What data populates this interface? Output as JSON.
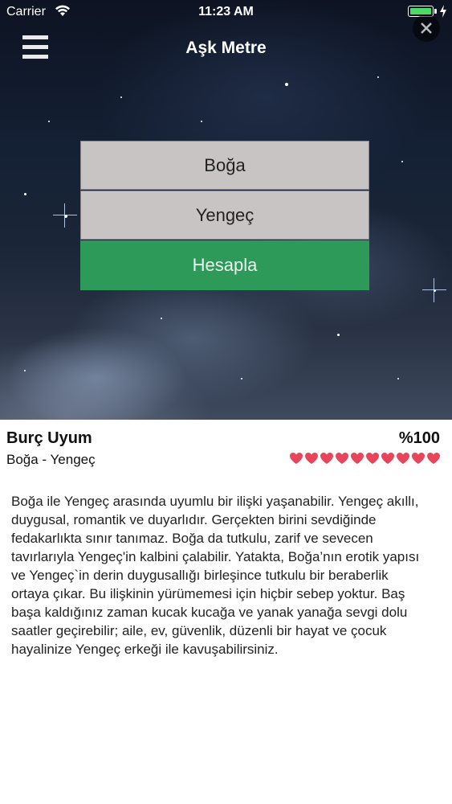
{
  "status_bar": {
    "carrier": "Carrier",
    "time": "11:23 AM"
  },
  "nav": {
    "title": "Aşk Metre",
    "menu_icon": "hamburger-menu-icon",
    "close_icon": "close-icon"
  },
  "selectors": {
    "first_sign": "Boğa",
    "second_sign": "Yengeç",
    "calculate_label": "Hesapla"
  },
  "result": {
    "title": "Burç Uyum",
    "percent": "%100",
    "pair": "Boğa - Yengeç",
    "hearts_filled": 10,
    "hearts_total": 10,
    "description": "Boğa ile Yengeç arasında uyumlu bir ilişki yaşanabilir. Yengeç akıllı, duygusal, romantik ve duyarlıdır. Gerçekten birini sevdiğinde fedakarlıkta sınır tanımaz. Boğa da tutkulu, zarif ve sevecen tavırlarıyla Yengeç'in kalbini çalabilir. Yatakta, Boğa’nın erotik yapısı ve Yengeç`in derin duygusallığı birleşince tutkulu bir beraberlik ortaya çıkar. Bu ilişkinin yürümemesi için hiçbir sebep yoktur. Baş başa kaldığınız zaman kucak kucağa ve yanak yanağa sevgi dolu saatler geçirebilir; aile, ev, güvenlik, düzenli bir hayat ve çocuk hayalinize Yengeç erkeği ile kavuşabilirsiniz."
  },
  "colors": {
    "calculate_bg": "#2e9a5a",
    "selector_bg": "#c8c4c4",
    "heart": "#e8445a",
    "battery": "#4cd964"
  }
}
